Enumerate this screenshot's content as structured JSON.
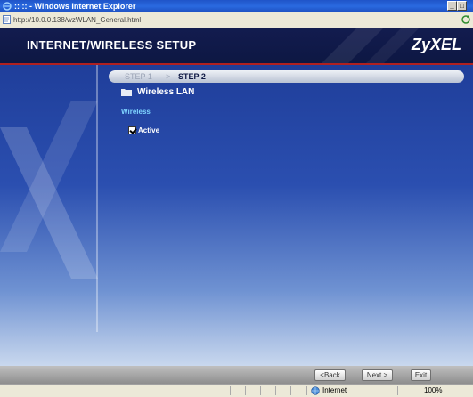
{
  "window": {
    "title": ":: :: - Windows Internet Explorer",
    "url": "http://10.0.0.138/wzWLAN_General.html"
  },
  "header": {
    "title": "INTERNET/WIRELESS SETUP",
    "logo": "ZyXEL"
  },
  "steps": {
    "step1": "STEP 1",
    "separator": ">",
    "step2": "STEP 2"
  },
  "section": {
    "title": "Wireless LAN",
    "subtitle": "Wireless"
  },
  "form": {
    "active_label": "Active",
    "active_checked": true
  },
  "buttons": {
    "back": "<Back",
    "next": "Next >",
    "exit": "Exit"
  },
  "status": {
    "zone": "Internet",
    "zoom": "100%"
  },
  "colors": {
    "header_bg": "#131c4f",
    "accent_line": "#b02020",
    "subtitle": "#7fd4ff"
  }
}
